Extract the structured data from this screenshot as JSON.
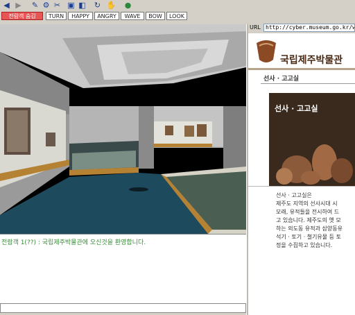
{
  "toolbar": {
    "icons": [
      "back-arrow-icon",
      "forward-arrow-icon",
      "tool-icon",
      "tool-icon",
      "tool-icon",
      "camera-icon",
      "view-icon",
      "rotate-icon",
      "hand-icon",
      "globe-icon"
    ]
  },
  "buttons": {
    "exit_label": "전람객 숨김",
    "turn_label": "TURN",
    "happy_label": "HAPPY",
    "angry_label": "ANGRY",
    "wave_label": "WAVE",
    "bow_label": "BOW",
    "look_label": "LOOK"
  },
  "chat": {
    "message": "전람객 1(??) : 국립제주박물관에 오신것을 환영합니다."
  },
  "browser": {
    "url_label": "URL",
    "url": "http://cyber.museum.go.kr/web/je"
  },
  "web": {
    "logo_title": "국립제주박물관",
    "section_head": "선사 · 고고실",
    "photo_title": "선사 · 고고실",
    "desc_lines": [
      "선사 · 고고실은",
      "제주도 지역의 선사시대 시",
      "모래, 유적들을 전시하여 드",
      "고 있습니다. 제주도의 옛 모",
      "하는 외도동 유적과 삼양동유",
      "석기 · 토기 · 철기유물 등 토",
      "정을 수집하고 있습니다."
    ]
  },
  "colors": {
    "chrome": "#d4d0c8",
    "exit_button": "#e85555",
    "chat_text": "#3a8a3a",
    "floor": "#1d4a5c"
  }
}
